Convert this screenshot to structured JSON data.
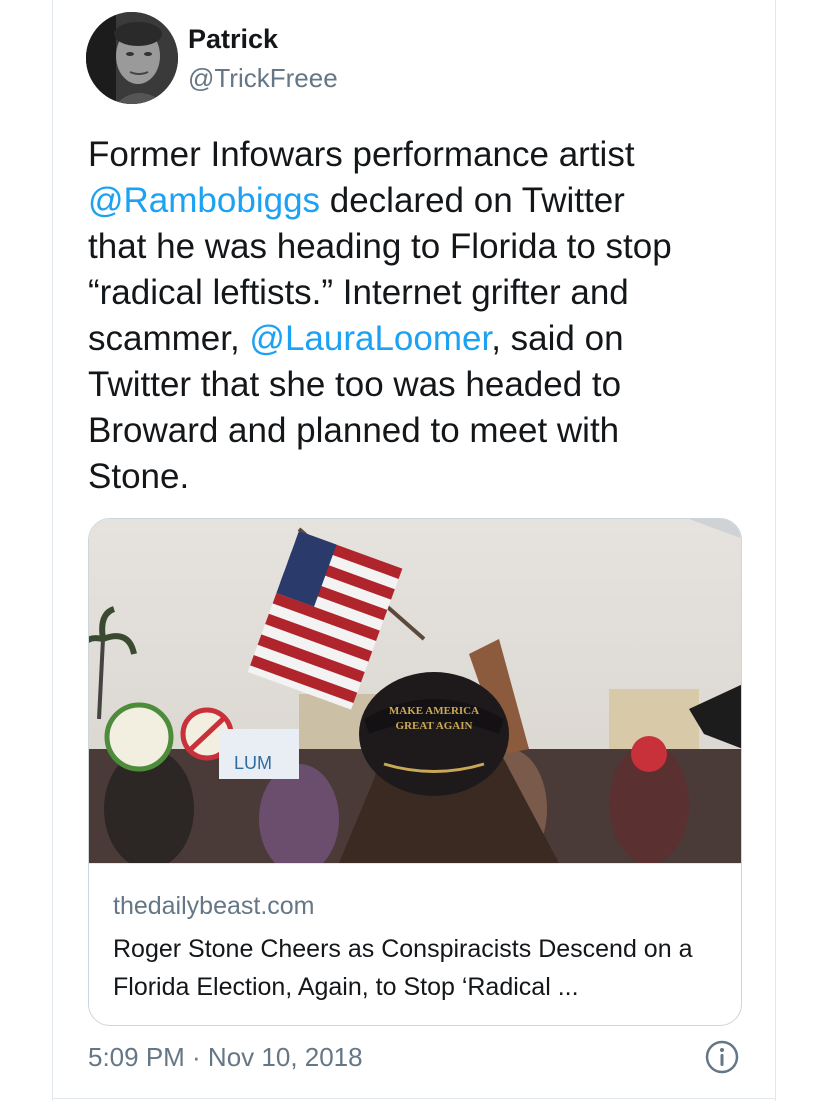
{
  "tweet": {
    "display_name": "Patrick",
    "handle": "@TrickFreee",
    "avatar_icon": "user-avatar",
    "text": {
      "p1": "Former Infowars performance artist\n",
      "mention1": "@Rambobiggs",
      "p2": " declared on Twitter\nthat he was heading to Florida to stop\n“radical leftists.” Internet grifter and\nscammer, ",
      "mention2": "@LauraLoomer",
      "p3": ", said on\nTwitter that she too was headed to\nBroward and planned to meet with\nStone."
    },
    "card": {
      "image_hat_text_line1": "MAKE AMERICA",
      "image_hat_text_line2": "GREAT AGAIN",
      "image_sign_text": "LUM",
      "domain": "thedailybeast.com",
      "title": "Roger Stone Cheers as Conspiracists Descend on a Florida Election, Again, to Stop ‘Radical ..."
    },
    "timestamp": "5:09 PM · Nov 10, 2018",
    "info_icon": "info-icon",
    "mention_color": "#1da1f2"
  }
}
